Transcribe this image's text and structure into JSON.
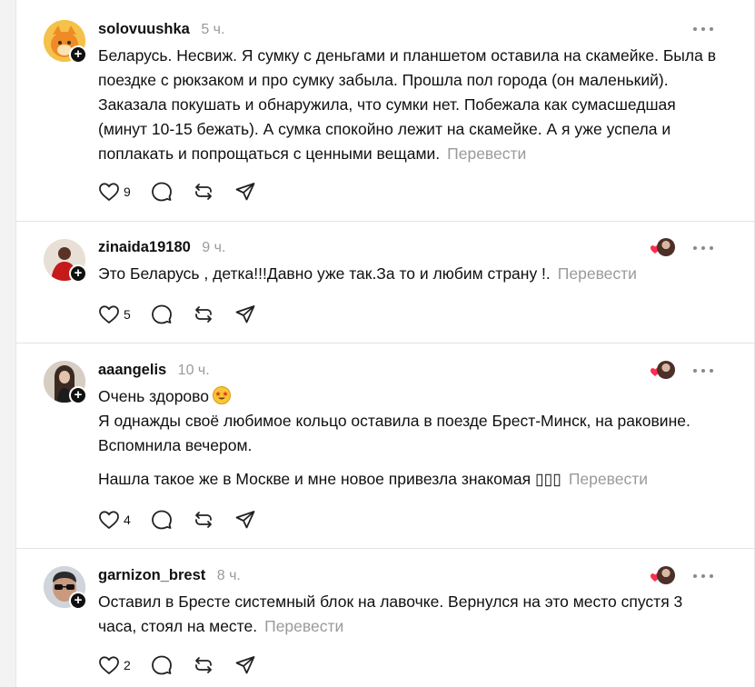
{
  "colors": {
    "accent_red": "#ff2d4f",
    "muted": "#9a9a9a",
    "text": "#101010"
  },
  "comments": [
    {
      "username": "solovuushka",
      "time": "5 ч.",
      "paragraphs": [
        "Беларусь. Несвиж. Я сумку с деньгами и планшетом оставила на скамейке. Была в поездке с рюкзаком и про сумку забыла. Прошла пол города (он маленький). Заказала покушать и обнаружила, что сумки нет. Побежала как сумасшедшая (минут 10-15 бежать). А сумка спокойно лежит на скамейке. А я уже успела и поплакать и попрощаться с ценными вещами."
      ],
      "translate": "Перевести",
      "likes": "9",
      "liked_by_author": false
    },
    {
      "username": "zinaida19180",
      "time": "9 ч.",
      "paragraphs": [
        "Это Беларусь , детка!!!Давно уже так.За то и любим страну !."
      ],
      "translate": "Перевести",
      "likes": "5",
      "liked_by_author": true
    },
    {
      "username": "aaangelis",
      "time": "10 ч.",
      "paragraphs": [
        "Очень здорово",
        "Я однажды своё любимое кольцо оставила в поезде Брест-Минск, на раковине. Вспомнила вечером.",
        "Нашла такое же в Москве и мне новое привезла знакомая ▯▯▯"
      ],
      "translate": "Перевести",
      "likes": "4",
      "liked_by_author": true
    },
    {
      "username": "garnizon_brest",
      "time": "8 ч.",
      "paragraphs": [
        "Оставил в Бресте системный блок на лавочке. Вернулся на это место спустя 3 часа, стоял на месте."
      ],
      "translate": "Перевести",
      "likes": "2",
      "liked_by_author": true
    }
  ]
}
